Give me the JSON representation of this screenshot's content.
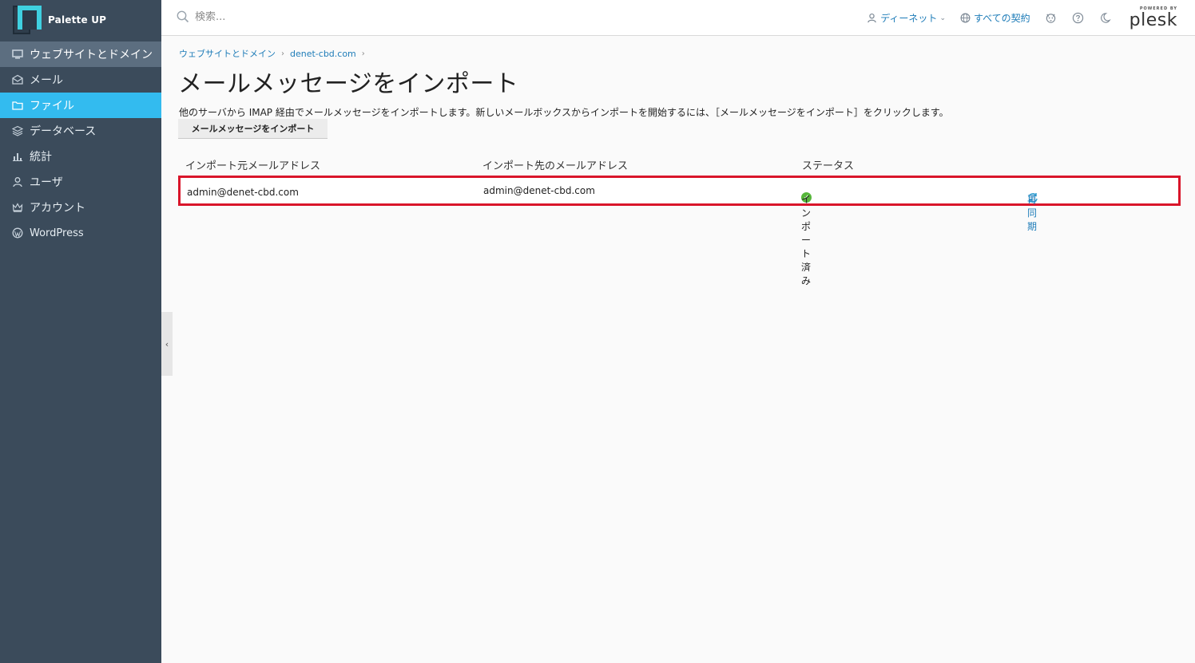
{
  "brand": {
    "name": "Palette UP"
  },
  "sidebar": {
    "items": [
      {
        "label": "ウェブサイトとドメイン",
        "icon": "monitor-icon"
      },
      {
        "label": "メール",
        "icon": "mail-icon"
      },
      {
        "label": "ファイル",
        "icon": "folder-icon"
      },
      {
        "label": "データベース",
        "icon": "layers-icon"
      },
      {
        "label": "統計",
        "icon": "bar-chart-icon"
      },
      {
        "label": "ユーザ",
        "icon": "user-icon"
      },
      {
        "label": "アカウント",
        "icon": "crown-icon"
      },
      {
        "label": "WordPress",
        "icon": "wordpress-icon"
      }
    ]
  },
  "header": {
    "search_placeholder": "検索...",
    "user_label": "ディーネット",
    "subscriptions_label": "すべての契約",
    "powered_by": "POWERED BY",
    "plesk": "plesk"
  },
  "breadcrumb": [
    "ウェブサイトとドメイン",
    "denet-cbd.com"
  ],
  "page": {
    "title": "メールメッセージをインポート",
    "description": "他のサーバから IMAP 経由でメールメッセージをインポートします。新しいメールボックスからインポートを開始するには、［メールメッセージをインポート］をクリックします。",
    "import_button": "メールメッセージをインポート"
  },
  "table": {
    "columns": [
      "インポート元メールアドレス",
      "インポート先のメールアドレス",
      "ステータス"
    ],
    "rows": [
      {
        "source": "admin@denet-cbd.com",
        "target": "admin@denet-cbd.com",
        "status": "インポート済み",
        "action": "再同期"
      }
    ]
  },
  "colors": {
    "sidebar_bg": "#3b4b5b",
    "active_item": "#33bbef",
    "link": "#1e7cb8",
    "highlight_border": "#d9152a",
    "status_ok": "#56b63a"
  }
}
